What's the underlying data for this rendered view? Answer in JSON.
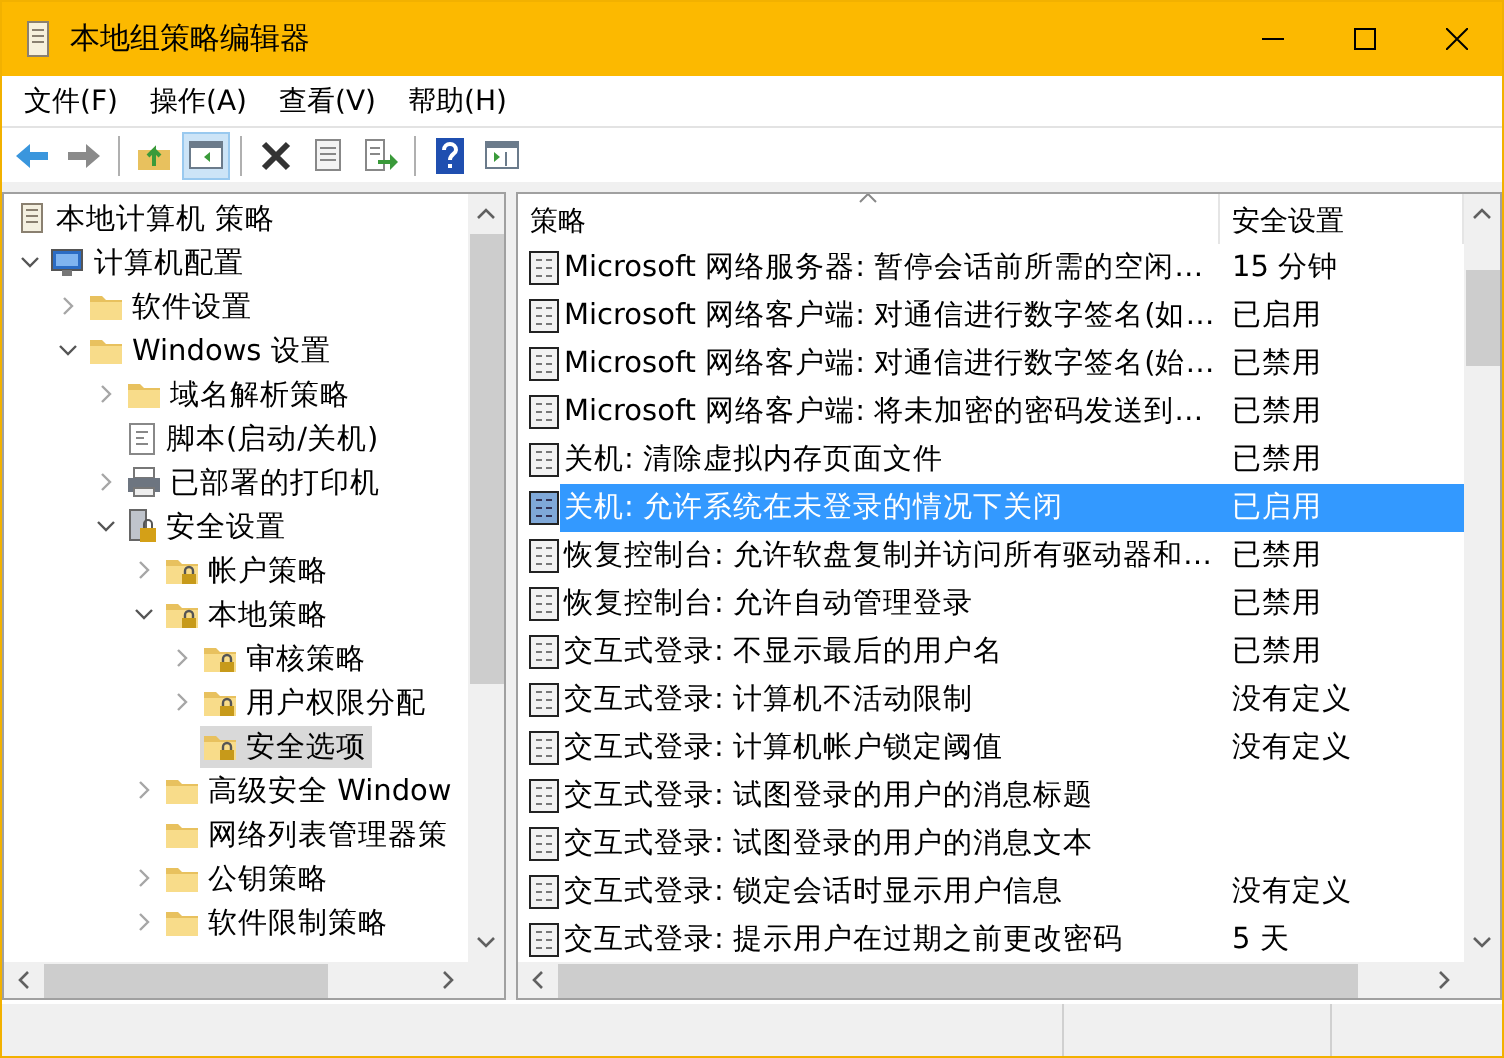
{
  "window": {
    "title": "本地组策略编辑器"
  },
  "menu": [
    "文件(F)",
    "操作(A)",
    "查看(V)",
    "帮助(H)"
  ],
  "toolbar": [
    {
      "kind": "back",
      "pressed": false
    },
    {
      "kind": "forward",
      "pressed": false
    },
    {
      "kind": "separator"
    },
    {
      "kind": "up",
      "pressed": false
    },
    {
      "kind": "tree-toggle",
      "pressed": true
    },
    {
      "kind": "separator"
    },
    {
      "kind": "delete",
      "pressed": false
    },
    {
      "kind": "properties",
      "pressed": false
    },
    {
      "kind": "export",
      "pressed": false
    },
    {
      "kind": "separator"
    },
    {
      "kind": "help",
      "pressed": false
    },
    {
      "kind": "action-pane",
      "pressed": false
    }
  ],
  "tree": [
    {
      "label": "本地计算机 策略",
      "kind": "policy",
      "selected": false,
      "children": [
        {
          "label": "计算机配置",
          "kind": "computer",
          "expanded": true,
          "selected": false,
          "children": [
            {
              "label": "软件设置",
              "kind": "folder",
              "expanded": false,
              "selected": false
            },
            {
              "label": "Windows 设置",
              "kind": "folder",
              "expanded": true,
              "selected": false,
              "children": [
                {
                  "label": "域名解析策略",
                  "kind": "folder",
                  "expanded": false,
                  "selected": false
                },
                {
                  "label": "脚本(启动/关机)",
                  "kind": "script",
                  "selected": false
                },
                {
                  "label": "已部署的打印机",
                  "kind": "printer",
                  "expanded": false,
                  "selected": false
                },
                {
                  "label": "安全设置",
                  "kind": "security",
                  "expanded": true,
                  "selected": false,
                  "children": [
                    {
                      "label": "帐户策略",
                      "kind": "locked-folder",
                      "expanded": false,
                      "selected": false
                    },
                    {
                      "label": "本地策略",
                      "kind": "locked-folder",
                      "expanded": true,
                      "selected": false,
                      "children": [
                        {
                          "label": "审核策略",
                          "kind": "locked-folder",
                          "expanded": false,
                          "selected": false
                        },
                        {
                          "label": "用户权限分配",
                          "kind": "locked-folder",
                          "expanded": false,
                          "selected": false
                        },
                        {
                          "label": "安全选项",
                          "kind": "locked-folder",
                          "selected": true
                        }
                      ]
                    },
                    {
                      "label": "高级安全 Window",
                      "kind": "folder",
                      "expanded": false,
                      "selected": false
                    },
                    {
                      "label": "网络列表管理器策",
                      "kind": "folder",
                      "selected": false
                    },
                    {
                      "label": "公钥策略",
                      "kind": "folder",
                      "expanded": false,
                      "selected": false
                    },
                    {
                      "label": "软件限制策略",
                      "kind": "folder",
                      "expanded": false,
                      "selected": false
                    }
                  ]
                }
              ]
            }
          ]
        }
      ]
    }
  ],
  "table": {
    "columns": [
      {
        "label": "策略",
        "sorted": true
      },
      {
        "label": "安全设置",
        "sorted": false
      }
    ],
    "rows": [
      {
        "policy": "Microsoft 网络服务器: 暂停会话前所需的空闲…",
        "setting": "15 分钟",
        "selected": false
      },
      {
        "policy": "Microsoft 网络客户端: 对通信进行数字签名(如…",
        "setting": "已启用",
        "selected": false
      },
      {
        "policy": "Microsoft 网络客户端: 对通信进行数字签名(始…",
        "setting": "已禁用",
        "selected": false
      },
      {
        "policy": "Microsoft 网络客户端: 将未加密的密码发送到…",
        "setting": "已禁用",
        "selected": false
      },
      {
        "policy": "关机: 清除虚拟内存页面文件",
        "setting": "已禁用",
        "selected": false
      },
      {
        "policy": "关机: 允许系统在未登录的情况下关闭",
        "setting": "已启用",
        "selected": true
      },
      {
        "policy": "恢复控制台: 允许软盘复制并访问所有驱动器和…",
        "setting": "已禁用",
        "selected": false
      },
      {
        "policy": "恢复控制台: 允许自动管理登录",
        "setting": "已禁用",
        "selected": false
      },
      {
        "policy": "交互式登录: 不显示最后的用户名",
        "setting": "已禁用",
        "selected": false
      },
      {
        "policy": "交互式登录: 计算机不活动限制",
        "setting": "没有定义",
        "selected": false
      },
      {
        "policy": "交互式登录: 计算机帐户锁定阈值",
        "setting": "没有定义",
        "selected": false
      },
      {
        "policy": "交互式登录: 试图登录的用户的消息标题",
        "selected": false
      },
      {
        "policy": "交互式登录: 试图登录的用户的消息文本",
        "selected": false
      },
      {
        "policy": "交互式登录: 锁定会话时显示用户信息",
        "setting": "没有定义",
        "selected": false
      },
      {
        "policy": "交互式登录: 提示用户在过期之前更改密码",
        "setting": "5 天",
        "selected": false
      }
    ]
  }
}
